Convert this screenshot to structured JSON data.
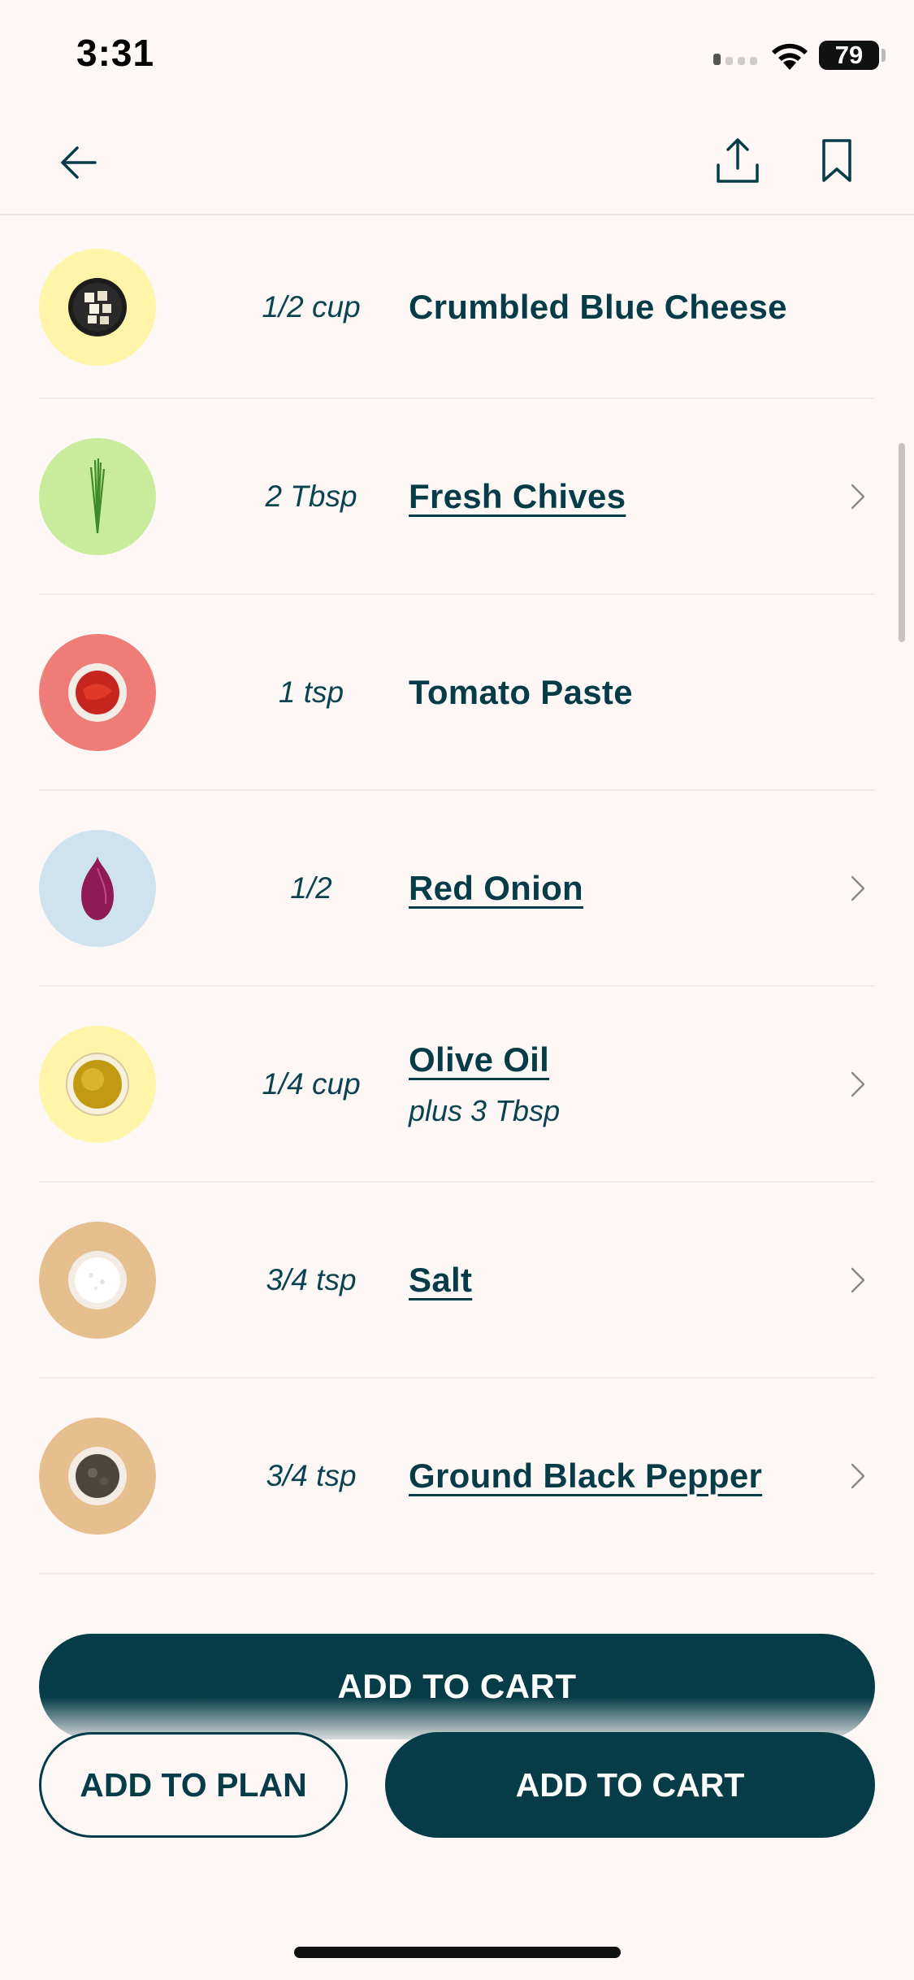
{
  "status_bar": {
    "time": "3:31",
    "battery": "79"
  },
  "nav": {
    "back_icon": "arrow-left-icon",
    "share_icon": "share-icon",
    "bookmark_icon": "bookmark-icon"
  },
  "ingredients": [
    {
      "qty": "1/2 cup",
      "name": "Crumbled Blue Cheese",
      "note": "",
      "link": false,
      "bg": "#fff4a8"
    },
    {
      "qty": "2 Tbsp",
      "name": "Fresh Chives",
      "note": "",
      "link": true,
      "bg": "#c9ec9c"
    },
    {
      "qty": "1 tsp",
      "name": "Tomato Paste",
      "note": "",
      "link": false,
      "bg": "#f07c78"
    },
    {
      "qty": "1/2",
      "name": "Red Onion",
      "note": "",
      "link": true,
      "bg": "#cfe3ef"
    },
    {
      "qty": "1/4 cup",
      "name": "Olive Oil",
      "note": "plus 3 Tbsp",
      "link": true,
      "bg": "#fff4a8"
    },
    {
      "qty": "3/4 tsp",
      "name": "Salt",
      "note": "",
      "link": true,
      "bg": "#e6bf8f"
    },
    {
      "qty": "3/4 tsp",
      "name": "Ground Black Pepper",
      "note": "",
      "link": true,
      "bg": "#e6bf8f"
    }
  ],
  "buttons": {
    "ghost_cart": "ADD TO CART",
    "add_to_plan": "ADD TO PLAN",
    "add_to_cart": "ADD TO CART"
  },
  "colors": {
    "primary": "#053c48",
    "background": "#fdf8f6"
  }
}
